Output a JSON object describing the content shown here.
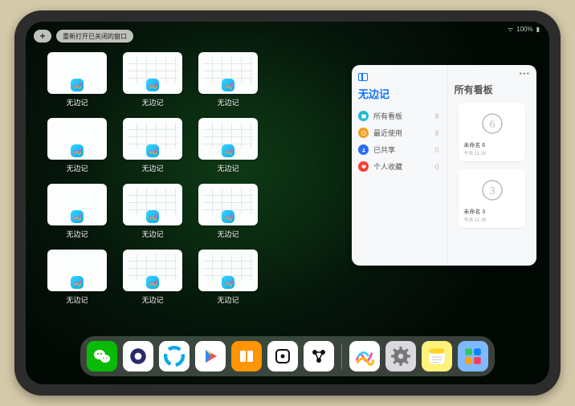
{
  "status": {
    "wifi": "ᯤ",
    "battery": "100%",
    "batt_icon": "▮"
  },
  "topbar": {
    "plus_label": "+",
    "reopen_label": "重新打开已关闭的窗口"
  },
  "app_switcher": {
    "app_name": "无边记",
    "thumbs": [
      {
        "label": "无边记",
        "variant": "blank"
      },
      {
        "label": "无边记",
        "variant": "board"
      },
      {
        "label": "无边记",
        "variant": "board"
      },
      null,
      {
        "label": "无边记",
        "variant": "blank"
      },
      {
        "label": "无边记",
        "variant": "board"
      },
      {
        "label": "无边记",
        "variant": "board"
      },
      null,
      {
        "label": "无边记",
        "variant": "blank"
      },
      {
        "label": "无边记",
        "variant": "board"
      },
      {
        "label": "无边记",
        "variant": "board"
      },
      null,
      {
        "label": "无边记",
        "variant": "blank"
      },
      {
        "label": "无边记",
        "variant": "board"
      },
      {
        "label": "无边记",
        "variant": "board"
      }
    ]
  },
  "sidebar_panel": {
    "left_title": "无边记",
    "categories": [
      {
        "label": "所有看板",
        "count": "8",
        "color": "#1fbad6"
      },
      {
        "label": "最近使用",
        "count": "8",
        "color": "#f0a020"
      },
      {
        "label": "已共享",
        "count": "0",
        "color": "#2a6df4"
      },
      {
        "label": "个人收藏",
        "count": "0",
        "color": "#ff3b30"
      }
    ],
    "right_title": "所有看板",
    "more": "•••",
    "boards": [
      {
        "name": "未命名 6",
        "time": "今天 11:28",
        "sketch": "6"
      },
      {
        "name": "未命名 3",
        "time": "今天 11:26",
        "sketch": "3"
      }
    ]
  },
  "dock": {
    "apps": [
      {
        "id": "wechat",
        "bg": "#09bb07",
        "glyph": "wechat"
      },
      {
        "id": "quark",
        "bg": "#ffffff",
        "glyph": "quark"
      },
      {
        "id": "qqbrowser",
        "bg": "#ffffff",
        "glyph": "qqb"
      },
      {
        "id": "play",
        "bg": "#ffffff",
        "glyph": "play"
      },
      {
        "id": "books",
        "bg": "#ff9500",
        "glyph": "books"
      },
      {
        "id": "dice",
        "bg": "#ffffff",
        "glyph": "dice"
      },
      {
        "id": "obs",
        "bg": "#ffffff",
        "glyph": "obs"
      }
    ],
    "recent": [
      {
        "id": "freeform",
        "bg": "#ffffff",
        "glyph": "freeform"
      },
      {
        "id": "settings",
        "bg": "#d9d9de",
        "glyph": "gear"
      },
      {
        "id": "notes",
        "bg": "#fff27a",
        "glyph": "notes"
      },
      {
        "id": "widgets",
        "bg": "#7fb9ff",
        "glyph": "widgets"
      }
    ]
  }
}
